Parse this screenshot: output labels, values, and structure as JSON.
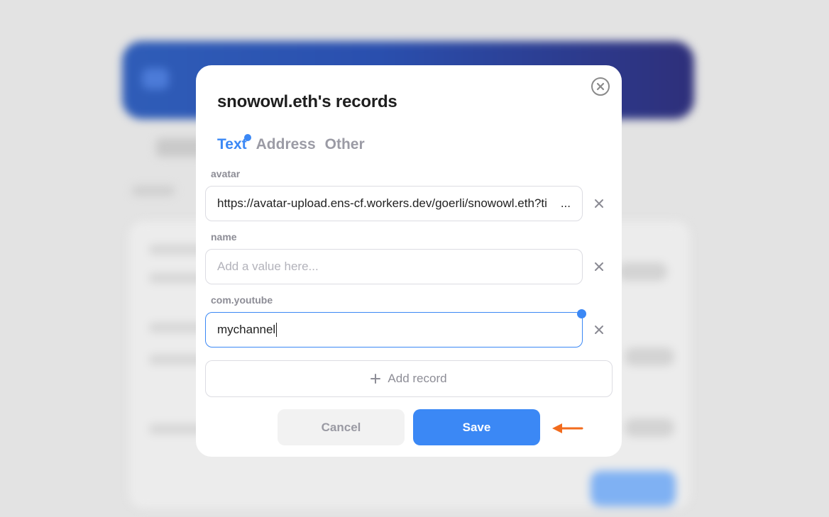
{
  "modal": {
    "title": "snowowl.eth's records",
    "tabs": [
      {
        "label": "Text",
        "active": true
      },
      {
        "label": "Address",
        "active": false
      },
      {
        "label": "Other",
        "active": false
      }
    ],
    "records": [
      {
        "key": "avatar",
        "value": "https://avatar-upload.ens-cf.workers.dev/goerli/snowowl.eth?ti",
        "truncation": "...",
        "placeholder": ""
      },
      {
        "key": "name",
        "value": "",
        "placeholder": "Add a value here..."
      },
      {
        "key": "com.youtube",
        "value": "mychannel",
        "placeholder": ""
      }
    ],
    "add_record_label": "Add record",
    "cancel_label": "Cancel",
    "save_label": "Save"
  },
  "icons": {
    "close": "close-circle-icon",
    "remove": "x-icon",
    "add": "plus-icon",
    "pointer": "arrow-left-icon"
  },
  "colors": {
    "accent": "#3b88f5",
    "annotation_arrow": "#f26b1d"
  }
}
